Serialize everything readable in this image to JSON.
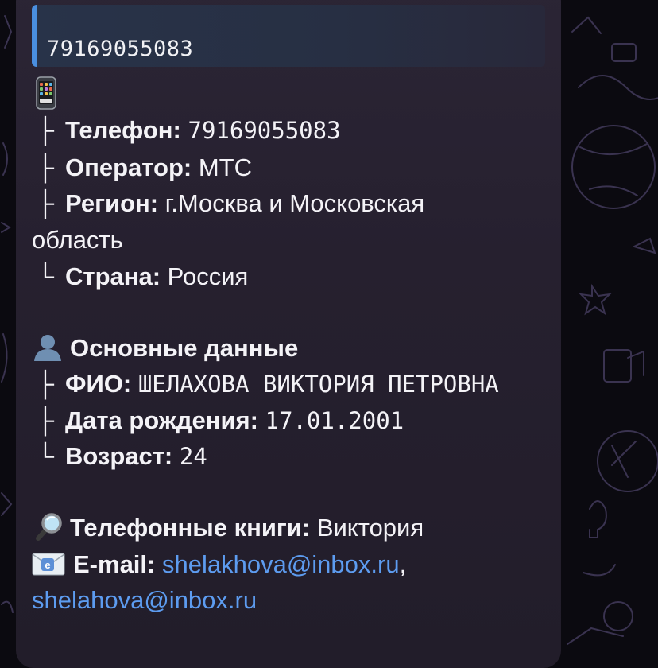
{
  "quote": {
    "text": "79169055083"
  },
  "phone_section": {
    "icon": "mobile-phone-icon",
    "rows": [
      {
        "branch": "├",
        "label": "Телефон:",
        "value": "79169055083"
      },
      {
        "branch": "├",
        "label": "Оператор:",
        "value": "МТС"
      },
      {
        "branch": "├",
        "label": "Регион:",
        "value": "г.Москва и Московская",
        "value_cont": "область"
      },
      {
        "branch": "└",
        "label": "Страна:",
        "value": "Россия"
      }
    ]
  },
  "basic_section": {
    "icon": "person-silhouette-icon",
    "title": "Основные данные",
    "rows": [
      {
        "branch": "├",
        "label": "ФИО:",
        "value": "ШЕЛАХОВА ВИКТОРИЯ ПЕТРОВНА"
      },
      {
        "branch": "├",
        "label": "Дата рождения:",
        "value": "17.01.2001"
      },
      {
        "branch": "└",
        "label": "Возраст:",
        "value": "24"
      }
    ]
  },
  "phonebooks": {
    "icon": "magnifier-icon",
    "label": "Телефонные книги:",
    "value": "Виктория"
  },
  "email": {
    "icon": "envelope-icon",
    "label": "E-mail:",
    "links": [
      "shelakhova@inbox.ru",
      "shelahova@inbox.ru"
    ],
    "separator": ","
  },
  "colors": {
    "link": "#5d9cf0",
    "quote_bar": "#4a8fe0",
    "bubble": "#26202f",
    "background": "#0b0a10"
  }
}
